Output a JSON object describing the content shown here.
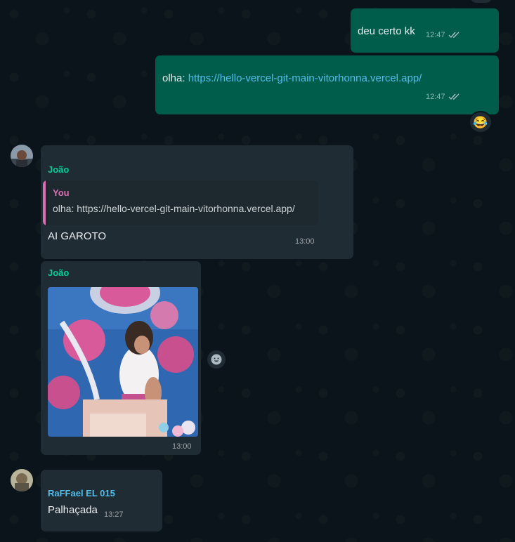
{
  "messages": {
    "m1": {
      "text": "deu certo kk",
      "time": "12:47"
    },
    "m2": {
      "prefix": "olha: ",
      "link": "https://hello-vercel-git-main-vitorhonna.vercel.app/",
      "time": "12:47",
      "reaction": "😂"
    },
    "m3": {
      "sender": "João",
      "quote_author": "You",
      "quote_text": "olha: https://hello-vercel-git-main-vitorhonna.vercel.app/",
      "text": "AI GAROTO",
      "time": "13:00"
    },
    "m4": {
      "sender": "João",
      "time": "13:00"
    },
    "m5": {
      "sender": "RaFFael EL 015",
      "text": "Palhaçada",
      "time": "13:27"
    }
  },
  "colors": {
    "outgoing_bubble": "#005c4b",
    "incoming_bubble": "#202c33",
    "link": "#53bdeb",
    "sender_joao": "#06cf9c",
    "sender_raffael": "#53bdeb",
    "quote_accent": "#d76fb0"
  },
  "icons": [
    "double-check-icon",
    "emoji-reaction-icon",
    "smiley-icon"
  ]
}
